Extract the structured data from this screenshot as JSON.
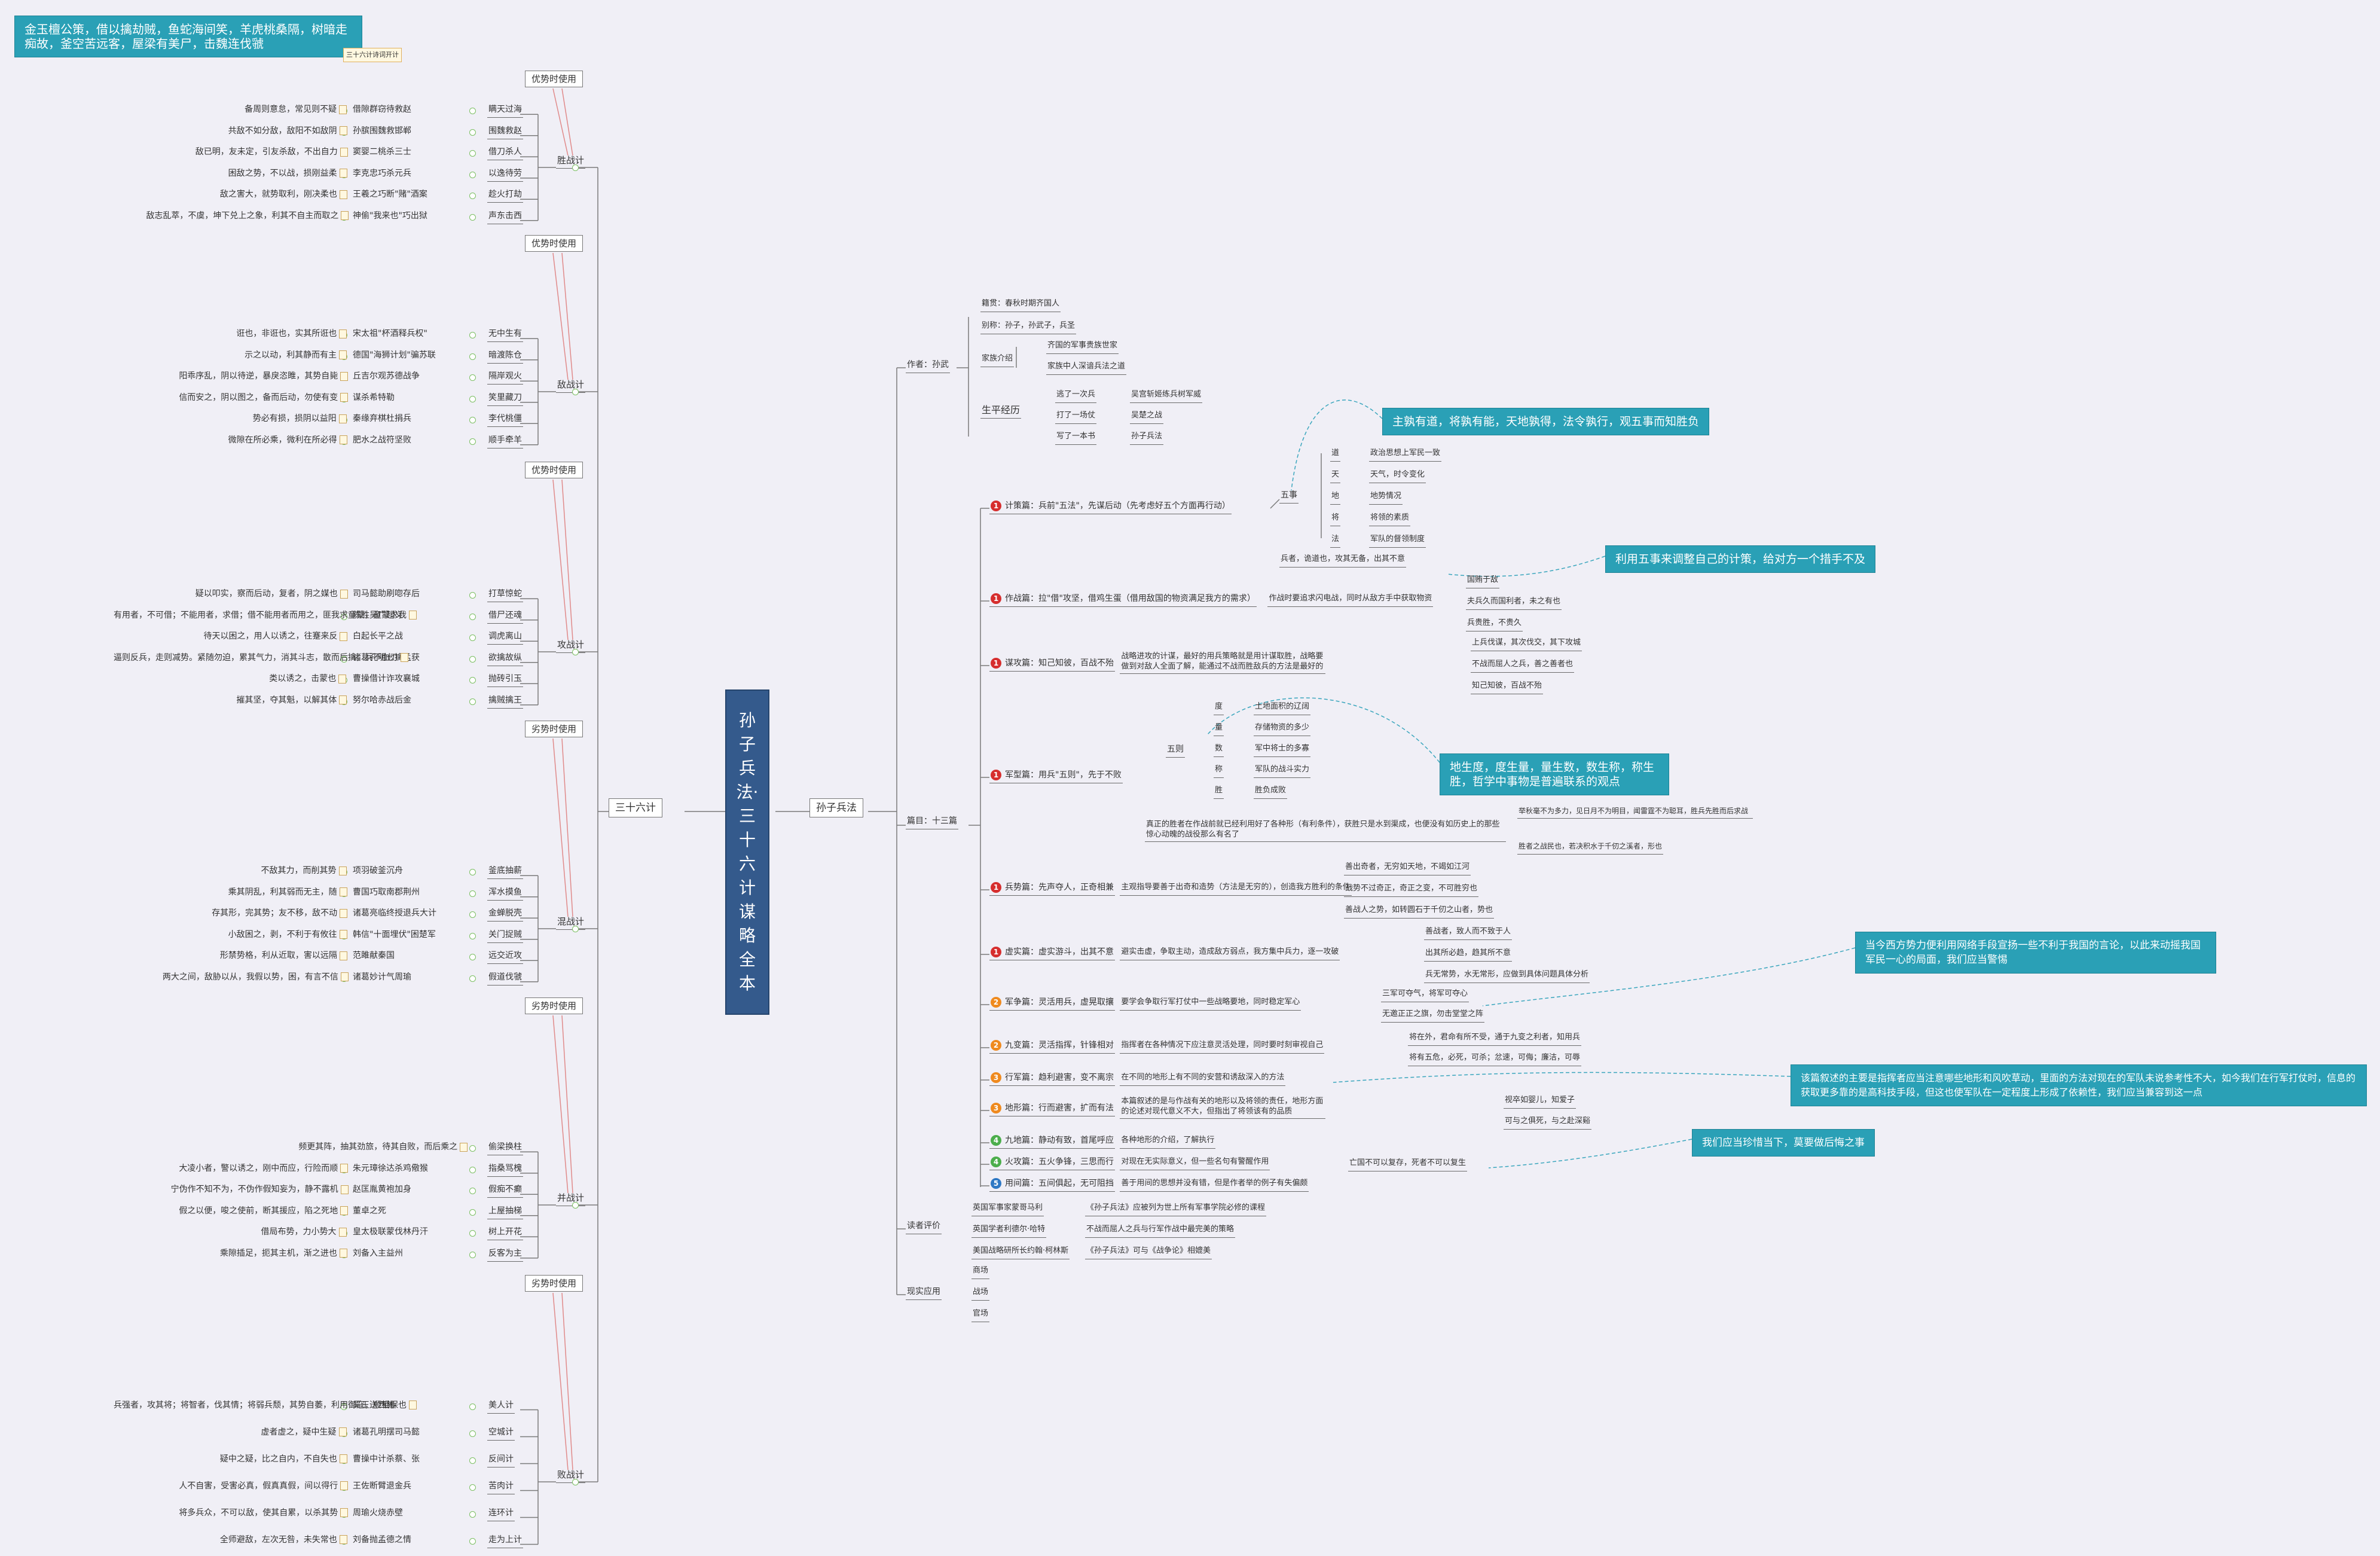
{
  "central": "孙子兵法·三十六计谋略全本",
  "left_root": "三十六计",
  "right_root": "孙子兵法",
  "top_banner": "金玉檀公策，借以擒劫贼，鱼蛇海间笑，羊虎桃桑隔，树暗走痴故，釜空苦远客，屋梁有美尸，击魏连伐虢",
  "top_banner_note": "三十六计诗词开计",
  "groups": [
    {
      "name": "胜战计",
      "tag": "优势时使用",
      "items": [
        [
          "备周则意怠，常见则不疑",
          "借隙群窃待救赵",
          "瞒天过海"
        ],
        [
          "共敌不如分敌，敌阳不如敌阴",
          "孙膑围魏救邯郸",
          "围魏救赵"
        ],
        [
          "敌已明，友未定，引友杀敌，不出自力",
          "窦婴二桃杀三士",
          "借刀杀人"
        ],
        [
          "困敌之势，不以战，损刚益柔",
          "李克忠巧杀元兵",
          "以逸待劳"
        ],
        [
          "敌之害大，就势取利，刚决柔也",
          "王羲之巧断\"赌\"酒案",
          "趁火打劫"
        ],
        [
          "敌志乱萃，不虞，坤下兑上之象，利其不自主而取之",
          "神偷\"我来也\"巧出狱",
          "声东击西"
        ]
      ]
    },
    {
      "name": "敌战计",
      "tag": "优势时使用",
      "items": [
        [
          "诳也，非诳也，实其所诳也",
          "宋太祖\"杯酒释兵权\"",
          "无中生有"
        ],
        [
          "示之以动，利其静而有主",
          "德国\"海狮计划\"骗苏联",
          "暗渡陈仓"
        ],
        [
          "阳乖序乱，阴以待逆，暴戾恣睢，其势自毙",
          "丘吉尔观苏德战争",
          "隔岸观火"
        ],
        [
          "信而安之，阴以图之，备而后动，勿使有变",
          "谋杀希特勒",
          "笑里藏刀"
        ],
        [
          "势必有损，损阴以益阳",
          "秦缘弃棋杜捐兵",
          "李代桃僵"
        ],
        [
          "微隙在所必乘，微利在所必得",
          "肥水之战符坚败",
          "顺手牵羊"
        ]
      ]
    },
    {
      "name": "攻战计",
      "tag": "优势时使用",
      "items": [
        [
          "疑以叩实，察而后动，复者，阴之媒也",
          "司马懿助刷唿存后",
          "打草惊蛇"
        ],
        [
          "有用者，不可借；不能用者，求借；借不能用者而用之，匪我求童蒙，童蒙求我",
          "陈胜吴广起义",
          "借尸还魂"
        ],
        [
          "待天以困之，用人以诱之，往蹇来反",
          "白起长平之战",
          "调虎离山"
        ],
        [
          "逼则反兵，走则减势。紧随勿迫，累其气力，消其斗志，散而后擒，兵不血刃",
          "诸葛孔明七擒孟获",
          "欲擒故纵"
        ],
        [
          "类以诱之，击蒙也",
          "曹操借计诈攻襄城",
          "抛砖引玉"
        ],
        [
          "摧其坚，夺其魁，以解其体",
          "努尔哈赤战后金",
          "擒贼擒王"
        ]
      ]
    },
    {
      "name": "混战计",
      "tag": "劣势时使用",
      "items": [
        [
          "不敌其力，而削其势",
          "项羽破釜沉舟",
          "釜底抽薪"
        ],
        [
          "乘其阴乱，利其弱而无主，随",
          "曹国巧取南郡荆州",
          "浑水摸鱼"
        ],
        [
          "存其形，完其势；友不移，敌不动",
          "诸葛亮临终授退兵大计",
          "金蝉脱壳"
        ],
        [
          "小敌困之，剥，不利于有攸往",
          "韩信\"十面埋伏\"困楚军",
          "关门捉贼"
        ],
        [
          "形禁势格，利从近取，害以远隔",
          "范雎献秦国",
          "远交近攻"
        ],
        [
          "两大之间，敌胁以从，我假以势，困，有言不信",
          "诸葛妙计气周瑜",
          "假道伐虢"
        ]
      ]
    },
    {
      "name": "并战计",
      "tag": "劣势时使用",
      "items": [
        [
          "频更其阵，抽其劲旅，待其自败，而后乘之",
          "偷梁换柱",
          ""
        ],
        [
          "大凌小者，警以诱之，刚中而应，行险而顺",
          "朱元璋徐达杀鸡儆猴",
          "指桑骂槐"
        ],
        [
          "宁伪作不知不为，不伪作假知妄为，静不露机",
          "赵匡胤黄袍加身",
          "假痴不癫"
        ],
        [
          "假之以便，唆之使前，断其援应，陷之死地",
          "董卓之死",
          "上屋抽梯"
        ],
        [
          "借局布势，力小势大",
          "皇太极联蒙伐林丹汗",
          "树上开花"
        ],
        [
          "乘隙插足，扼其主机，渐之进也",
          "刘备入主益州",
          "反客为主"
        ]
      ]
    },
    {
      "name": "败战计",
      "tag": "劣势时使用",
      "items": [
        [
          "兵强者，攻其将；将智者，伐其情；将弱兵颓，其势自萎，利用御寇，顺相保也",
          "吴王送西施",
          "美人计"
        ],
        [
          "虚者虚之，疑中生疑",
          "诸葛孔明摆司马懿",
          "空城计"
        ],
        [
          "疑中之疑，比之自内，不自失也",
          "曹操中计杀蔡、张",
          "反间计"
        ],
        [
          "人不自害，受害必真，假真真假，间以得行",
          "王佐断臂退金兵",
          "苦肉计"
        ],
        [
          "将多兵众，不可以敌，使其自累，以杀其势",
          "周瑜火烧赤壁",
          "连环计"
        ],
        [
          "全师避敌，左次无咎，未失常也",
          "刘备抛孟德之情",
          "走为上计"
        ]
      ]
    }
  ],
  "sunzi": {
    "author": {
      "label": "作者：孙武",
      "items": [
        "籍贯：春秋时期齐国人",
        "别称：孙子，孙武子，兵圣"
      ],
      "family": {
        "label": "家族介绍",
        "items": [
          "齐国的军事贵族世家",
          "家族中人深谙兵法之道"
        ]
      },
      "life": {
        "label": "生平经历",
        "items": [
          [
            "逃了一次兵",
            "吴宫斩姬练兵树军威"
          ],
          [
            "打了一场仗",
            "吴楚之战"
          ],
          [
            "写了一本书",
            "孙子兵法"
          ]
        ]
      }
    },
    "chapters_label": "篇目：十三篇",
    "chapters": [
      {
        "n": "1",
        "c": "red",
        "t": "计策篇：兵前\"五法\"，先谋后动（先考虑好五个方面再行动）"
      },
      {
        "n": "1",
        "c": "red",
        "t": "作战篇：拉\"借\"攻坚，借鸡生蛋（借用敌国的物资满足我方的需求）"
      },
      {
        "n": "1",
        "c": "red",
        "t": "谋攻篇：知己知彼，百战不殆"
      },
      {
        "n": "1",
        "c": "red",
        "t": "军型篇：用兵\"五则\"，先于不败"
      },
      {
        "n": "1",
        "c": "red",
        "t": "兵势篇：先声夺人，正奇相兼"
      },
      {
        "n": "1",
        "c": "red",
        "t": "虚实篇：虚实游斗，出其不意"
      },
      {
        "n": "2",
        "c": "ora",
        "t": "军争篇：灵活用兵，虚晃取攘"
      },
      {
        "n": "2",
        "c": "ora",
        "t": "九变篇：灵活指挥，针锋相对"
      },
      {
        "n": "3",
        "c": "ora",
        "t": "行军篇：趋利避害，变不离宗"
      },
      {
        "n": "3",
        "c": "ora",
        "t": "地形篇：行而避害，扩而有法"
      },
      {
        "n": "4",
        "c": "gre",
        "t": "九地篇：静动有致，首尾呼应"
      },
      {
        "n": "4",
        "c": "gre",
        "t": "火攻篇：五火争锋，三思而行"
      },
      {
        "n": "5",
        "c": "blu",
        "t": "用间篇：五间俱起，无可阻挡"
      }
    ],
    "wushi": {
      "label": "五事",
      "items": [
        [
          "道",
          "政治思想上军民一致"
        ],
        [
          "天",
          "天气，时令变化"
        ],
        [
          "地",
          "地势情况"
        ],
        [
          "将",
          "将领的素质"
        ],
        [
          "法",
          "军队的督领制度"
        ]
      ],
      "tail": "兵者，诡道也，攻其无备，出其不意"
    },
    "zuozhan": {
      "mid": "作战时要追求闪电战，同时从敌方手中获取物资",
      "items": [
        "国贿于敌",
        "夫兵久而国利者，未之有也",
        "兵贵胜，不贵久"
      ]
    },
    "mougong": {
      "mid": "战略进攻的计谋，最好的用兵策略就是用计谋取胜，战略要做到对敌人全面了解，能通过不战而胜敌兵的方法是最好的",
      "items": [
        "上兵伐谋，其次伐交，其下攻城",
        "不战而屈人之兵，善之善者也",
        "知己知彼，百战不殆"
      ]
    },
    "wuze": {
      "label": "五则",
      "items": [
        [
          "度",
          "土地面积的辽阔"
        ],
        [
          "量",
          "存储物资的多少"
        ],
        [
          "数",
          "军中将士的多寡"
        ],
        [
          "称",
          "军队的战斗实力"
        ],
        [
          "胜",
          "胜负成败"
        ]
      ],
      "extra": "真正的胜者在作战前就已经利用好了各种形（有利条件），获胜只是水到渠成，也便没有如历史上的那些惊心动魄的战役那么有名了",
      "extra_items": [
        "举秋毫不为多力，见日月不为明目，闻雷霆不为聪耳，胜兵先胜而后求战",
        "胜者之战民也，若决积水于千仞之溪者，形也"
      ]
    },
    "bingshi": {
      "mid": "主观指导要善于出奇和造势（方法是无穷的），创造我方胜利的条件",
      "items": [
        "善出奇者，无穷如天地，不竭如江河",
        "战势不过奇正，奇正之变，不可胜穷也",
        "善战人之势，如转圆石于千仞之山者，势也"
      ]
    },
    "xushi": {
      "mid": "避实击虚，争取主动，造成敌方弱点，我方集中兵力，逐一攻破",
      "items": [
        "善战者，致人而不致于人",
        "出其所必趋，趋其所不意",
        "兵无常势，水无常形，应做到具体问题具体分析"
      ]
    },
    "junzheng": {
      "mid": "要学会争取行军打仗中一些战略要地，同时稳定军心",
      "items": [
        "三军可夺气，将军可夺心",
        "无邀正正之旗，勿击堂堂之阵"
      ]
    },
    "jiubian": {
      "mid": "指挥者在各种情况下应注意灵活处理，同时要时刻审视自己",
      "items": [
        "将在外，君命有所不受，通于九变之利者，知用兵",
        "将有五危，必死，可杀；忿速，可侮；廉洁，可辱"
      ]
    },
    "xingjun": {
      "mid": "在不同的地形上有不同的安营和诱敌深入的方法"
    },
    "dixing": {
      "mid": "本篇叙述的是与作战有关的地形以及将领的责任，地形方面的论述对现代意义不大，但指出了将领该有的品质",
      "items": [
        "视卒如婴儿，知爱子",
        "可与之俱死，与之赴深谿"
      ]
    },
    "jiudi": {
      "mid": "各种地形的介绍，了解执行"
    },
    "huogong": {
      "mid": "对现在无实际意义，但一些名句有警醒作用",
      "item": "亡国不可以复存，死者不可以复生"
    },
    "yongjian": {
      "mid": "善于用间的思想并没有错，但是作者举的例子有失偏颇"
    },
    "review": {
      "label": "读者评价",
      "items": [
        [
          "英国军事家蒙哥马利",
          "《孙子兵法》应被列为世上所有军事学院必修的课程"
        ],
        [
          "英国学者利德尔·哈特",
          "不战而屈人之兵与行军作战中最完美的策略"
        ],
        [
          "美国战略研所长约翰·柯林斯",
          "《孙子兵法》可与《战争论》相媲美"
        ]
      ]
    },
    "apply": {
      "label": "现实应用",
      "items": [
        "商场",
        "战场",
        "官场"
      ]
    }
  },
  "callouts": {
    "c1": "主孰有道，将孰有能，天地孰得，法令孰行，观五事而知胜负",
    "c2": "利用五事来调整自己的计策，给对方一个措手不及",
    "c3": "地生度，度生量，量生数，数生称，称生胜，哲学中事物是普遍联系的观点",
    "c4": "当今西方势力便利用网络手段宣扬一些不利于我国的言论，以此来动摇我国军民一心的局面，我们应当警惕",
    "c5": "该篇叙述的主要是指挥者应当注意哪些地形和风吹草动，里面的方法对现在的军队未说参考性不大，如今我们在行军打仗时，信息的获取更多靠的是高科技手段，但这也使军队在一定程度上形成了依赖性，我们应当兼容到这一点",
    "c6": "我们应当珍惜当下，莫要做后悔之事"
  }
}
